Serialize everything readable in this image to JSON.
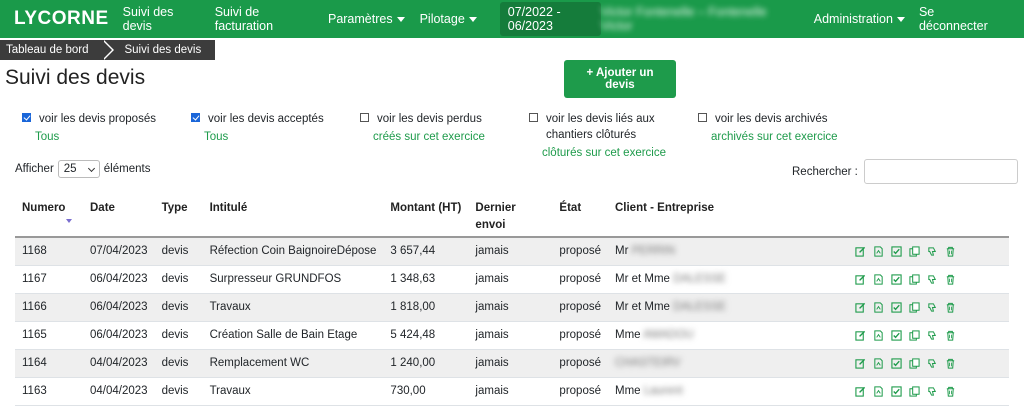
{
  "nav": {
    "brand": "LYCORNE",
    "items": [
      "Suivi des devis",
      "Suivi de facturation",
      "Paramètres",
      "Pilotage"
    ],
    "period": "07/2022 - 06/2023",
    "user": "Victor Fontenelle – Fontenelle Victor",
    "admin": "Administration",
    "logout": "Se déconnecter"
  },
  "breadcrumb": [
    "Tableau de bord",
    "Suivi des devis"
  ],
  "page": {
    "title": "Suivi des devis",
    "add_button": "+ Ajouter un devis"
  },
  "filters": [
    {
      "label": "voir les devis proposés",
      "sub": "Tous",
      "checked": true
    },
    {
      "label": "voir les devis acceptés",
      "sub": "Tous",
      "checked": true
    },
    {
      "label": "voir les devis perdus",
      "sub": "créés sur cet exercice",
      "checked": false
    },
    {
      "label": "voir les devis liés aux chantiers clôturés",
      "sub": "clôturés sur cet exercice",
      "checked": false
    },
    {
      "label": "voir les devis archivés",
      "sub": "archivés sur cet exercice",
      "checked": false
    }
  ],
  "length": {
    "prefix": "Afficher",
    "value": "25",
    "suffix": "éléments"
  },
  "search": {
    "label": "Rechercher :",
    "value": ""
  },
  "columns": [
    "Numero",
    "Date",
    "Type",
    "Intitulé",
    "Montant (HT)",
    "Dernier envoi",
    "État",
    "Client - Entreprise"
  ],
  "rows": [
    {
      "numero": "1168",
      "date": "07/04/2023",
      "type": "devis",
      "intitule": "Réfection Coin BaignoireDépose",
      "montant": "3 657,44",
      "envoi": "jamais",
      "etat": "proposé",
      "client_prefix": "Mr",
      "client_name": "PERRIN"
    },
    {
      "numero": "1167",
      "date": "06/04/2023",
      "type": "devis",
      "intitule": "Surpresseur GRUNDFOS",
      "montant": "1 348,63",
      "envoi": "jamais",
      "etat": "proposé",
      "client_prefix": "Mr et Mme",
      "client_name": "DALESSE"
    },
    {
      "numero": "1166",
      "date": "06/04/2023",
      "type": "devis",
      "intitule": "Travaux",
      "montant": "1 818,00",
      "envoi": "jamais",
      "etat": "proposé",
      "client_prefix": "Mr et Mme",
      "client_name": "DALESSE"
    },
    {
      "numero": "1165",
      "date": "06/04/2023",
      "type": "devis",
      "intitule": "Création Salle de Bain Etage",
      "montant": "5 424,48",
      "envoi": "jamais",
      "etat": "proposé",
      "client_prefix": "Mme",
      "client_name": "AMADOU"
    },
    {
      "numero": "1164",
      "date": "04/04/2023",
      "type": "devis",
      "intitule": "Remplacement WC",
      "montant": "1 240,00",
      "envoi": "jamais",
      "etat": "proposé",
      "client_prefix": "",
      "client_name": "CHASTEIRV"
    },
    {
      "numero": "1163",
      "date": "04/04/2023",
      "type": "devis",
      "intitule": "Travaux",
      "montant": "730,00",
      "envoi": "jamais",
      "etat": "proposé",
      "client_prefix": "Mme",
      "client_name": "Laurent"
    }
  ],
  "row_actions": [
    "edit-icon",
    "pdf-icon",
    "check-icon",
    "copy-icon",
    "thumbs-down-icon",
    "trash-icon"
  ],
  "colors": {
    "brand": "#1a9a4a",
    "link": "#1e9b4b",
    "checkbox": "#1a66d9"
  }
}
